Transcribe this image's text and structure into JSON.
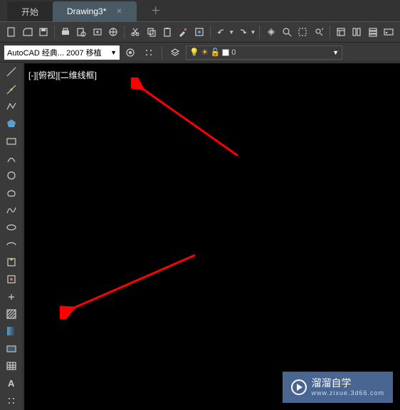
{
  "tabs": {
    "start": "开始",
    "drawing": "Drawing3*"
  },
  "workspace": {
    "selected": "AutoCAD 经典... 2007 移植"
  },
  "layer": {
    "name": "0"
  },
  "canvas": {
    "viewLabel": "[-][俯视][二维线框]"
  },
  "watermark": {
    "title": "溜溜自学",
    "url": "www.zixue.3d66.com"
  },
  "toolbar_icons": [
    "new-file",
    "open-file",
    "save",
    "print",
    "print-preview",
    "publish",
    "3d-print",
    "cut",
    "copy",
    "paste",
    "match-props",
    "block",
    "undo",
    "redo",
    "pan",
    "zoom-extents",
    "zoom-window",
    "zoom-previous",
    "properties",
    "sheet-set",
    "tool-palettes",
    "command-line"
  ],
  "left_tools": [
    "line",
    "construction-line",
    "polyline",
    "polygon",
    "rectangle",
    "arc",
    "circle",
    "revision-cloud",
    "spline",
    "ellipse",
    "ellipse-arc",
    "insert-block",
    "make-block",
    "point",
    "hatch",
    "gradient",
    "region",
    "table",
    "multiline-text",
    "add-selected"
  ]
}
